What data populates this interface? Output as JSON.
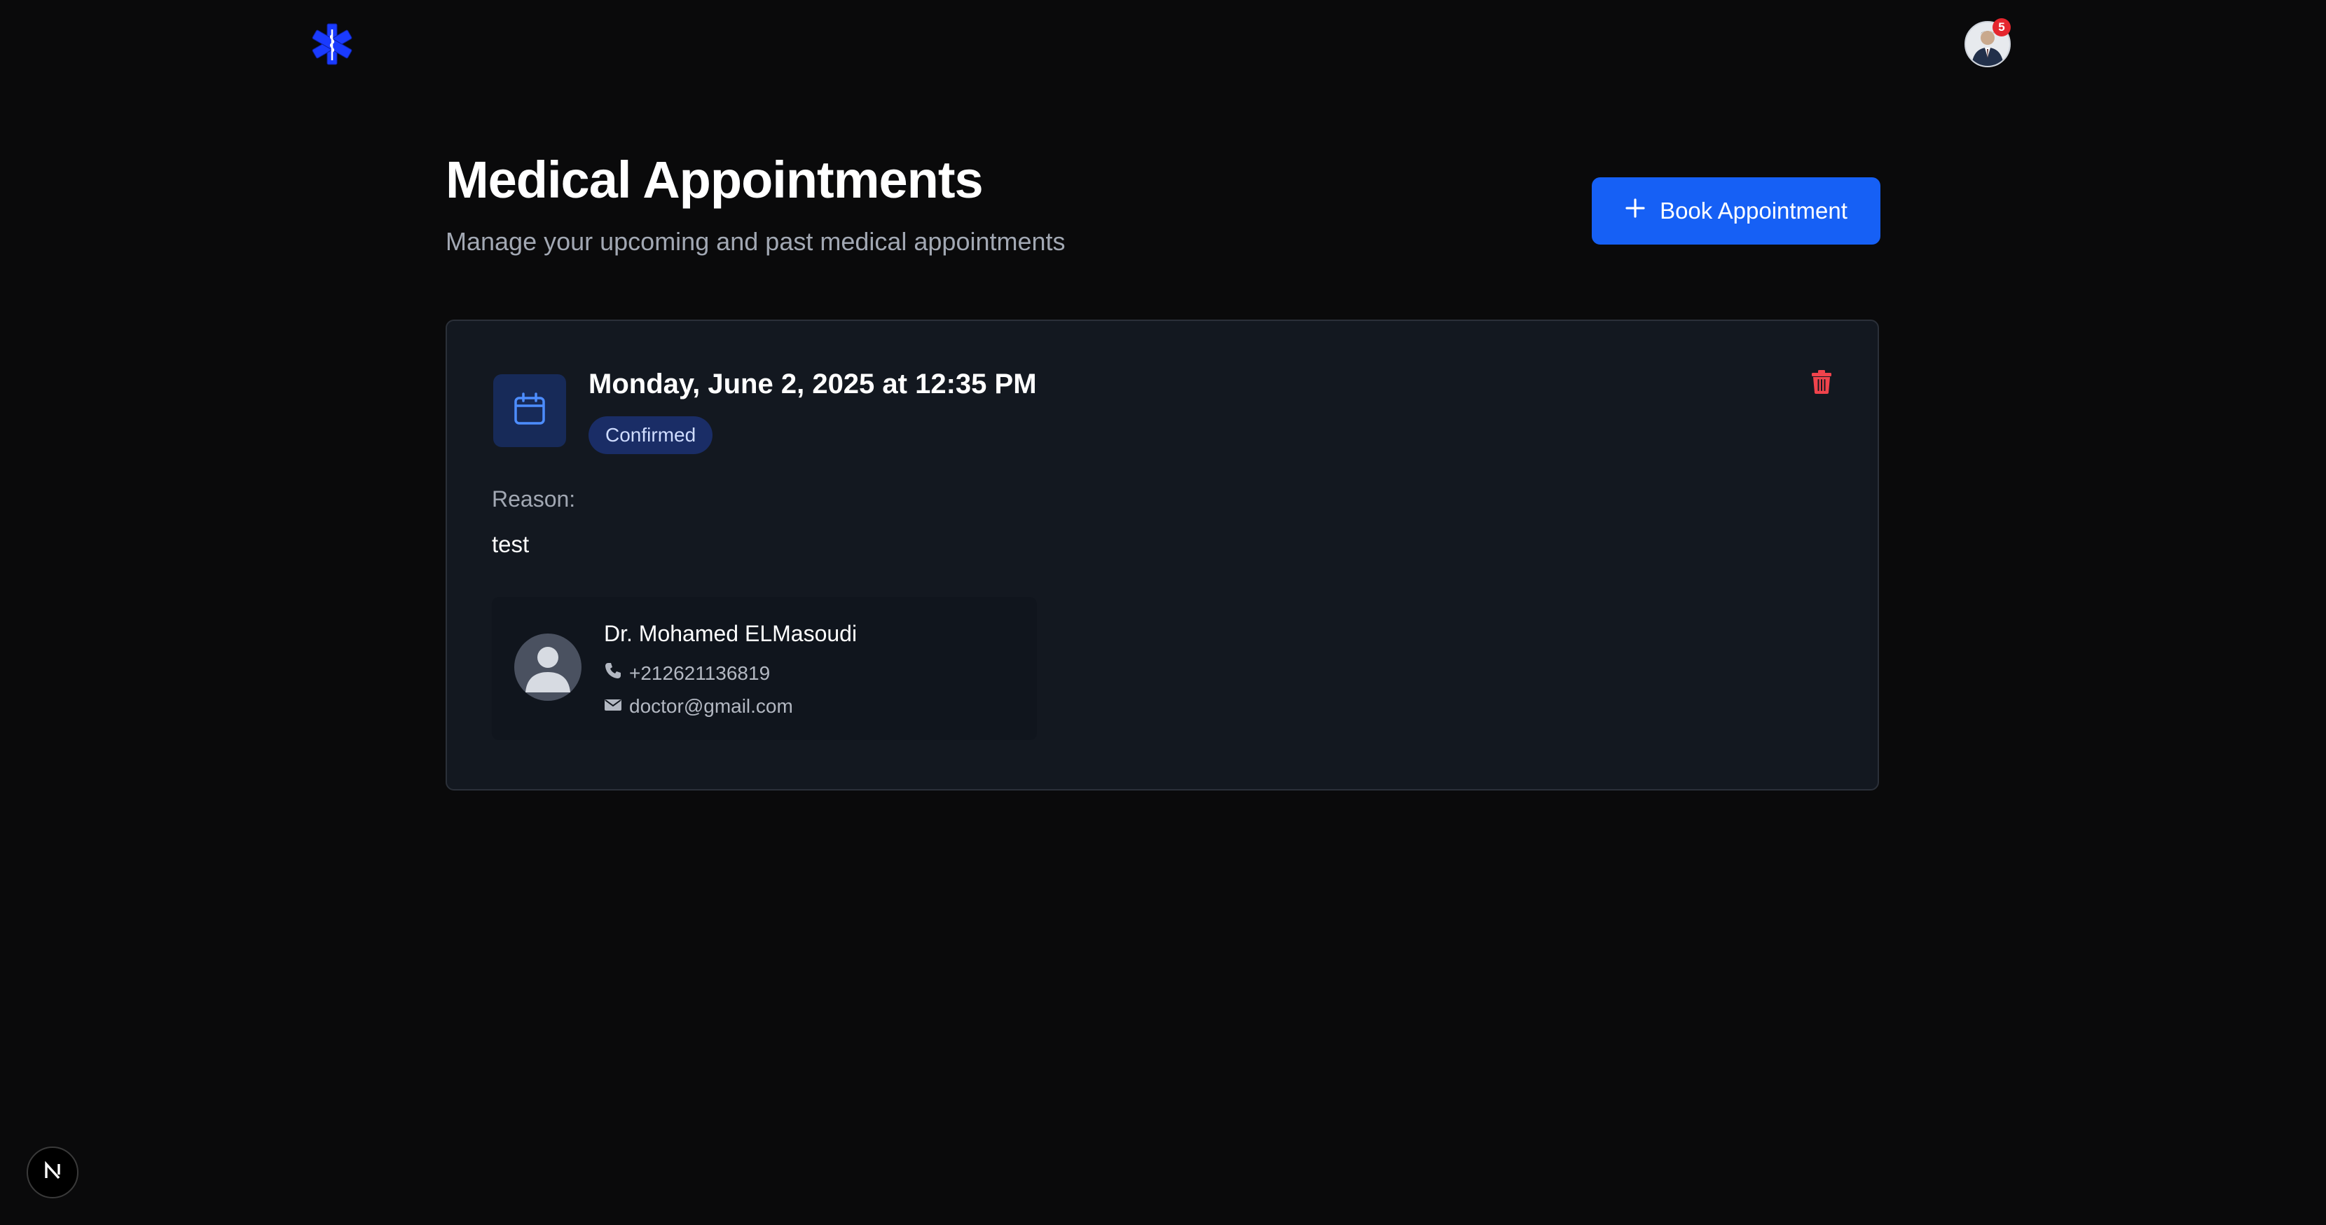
{
  "header": {
    "logo_icon": "star-of-life-icon",
    "logo_color": "#1a3bff",
    "avatar_icon": "user-photo-avatar",
    "notification_count": "5"
  },
  "page": {
    "title": "Medical Appointments",
    "subtitle": "Manage your upcoming and past medical appointments",
    "book_button_label": "Book Appointment",
    "accent_color": "#1660f5"
  },
  "appointment": {
    "datetime": "Monday, June 2, 2025 at 12:35 PM",
    "status": "Confirmed",
    "reason_label": "Reason:",
    "reason": "test",
    "doctor": {
      "name": "Dr. Mohamed ELMasoudi",
      "phone": "+212621136819",
      "email": "doctor@gmail.com"
    },
    "delete_color": "#f0434c"
  },
  "dev_indicator": {
    "label": "N"
  }
}
